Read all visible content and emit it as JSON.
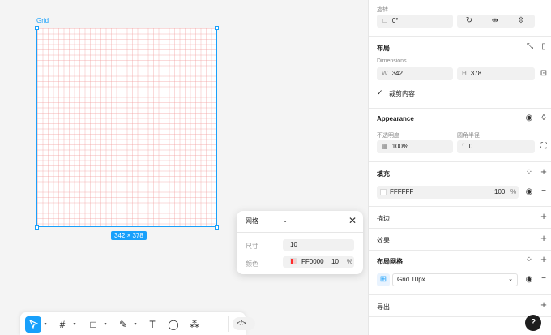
{
  "canvas": {
    "frame_label": "Grid",
    "size_badge": "342 × 378"
  },
  "grid_popup": {
    "type_value": "网格",
    "size_label": "尺寸",
    "size_value": "10",
    "color_label": "颜色",
    "color_hex": "FF0000",
    "color_opacity": "10",
    "percent": "%"
  },
  "toolbar": {
    "tools": [
      {
        "name": "move-tool",
        "glyph": "➤",
        "active": true
      },
      {
        "name": "frame-tool",
        "glyph": "#"
      },
      {
        "name": "shape-tool",
        "glyph": "□"
      },
      {
        "name": "pen-tool",
        "glyph": "✎"
      },
      {
        "name": "text-tool",
        "glyph": "T"
      },
      {
        "name": "comment-tool",
        "glyph": "◯"
      },
      {
        "name": "actions-tool",
        "glyph": "⁂"
      }
    ],
    "code_glyph": "</>"
  },
  "panel": {
    "rotation": {
      "label": "旋转",
      "value": "0°"
    },
    "layout": {
      "title": "布局",
      "dimensions_label": "Dimensions",
      "width_prefix": "W",
      "width_value": "342",
      "height_prefix": "H",
      "height_value": "378",
      "clip_label": "裁剪内容"
    },
    "appearance": {
      "title": "Appearance",
      "opacity_label": "不透明度",
      "opacity_value": "100%",
      "radius_label": "圆角半径",
      "radius_value": "0"
    },
    "fill": {
      "title": "填充",
      "hex": "FFFFFF",
      "opacity": "100",
      "percent": "%"
    },
    "stroke": {
      "title": "描边"
    },
    "effects": {
      "title": "效果"
    },
    "layout_grid": {
      "title": "布局网格",
      "value": "Grid 10px"
    },
    "export": {
      "title": "导出"
    },
    "help": "?"
  },
  "colors": {
    "accent": "#18a0fb",
    "grid_color": "#FF0000"
  }
}
